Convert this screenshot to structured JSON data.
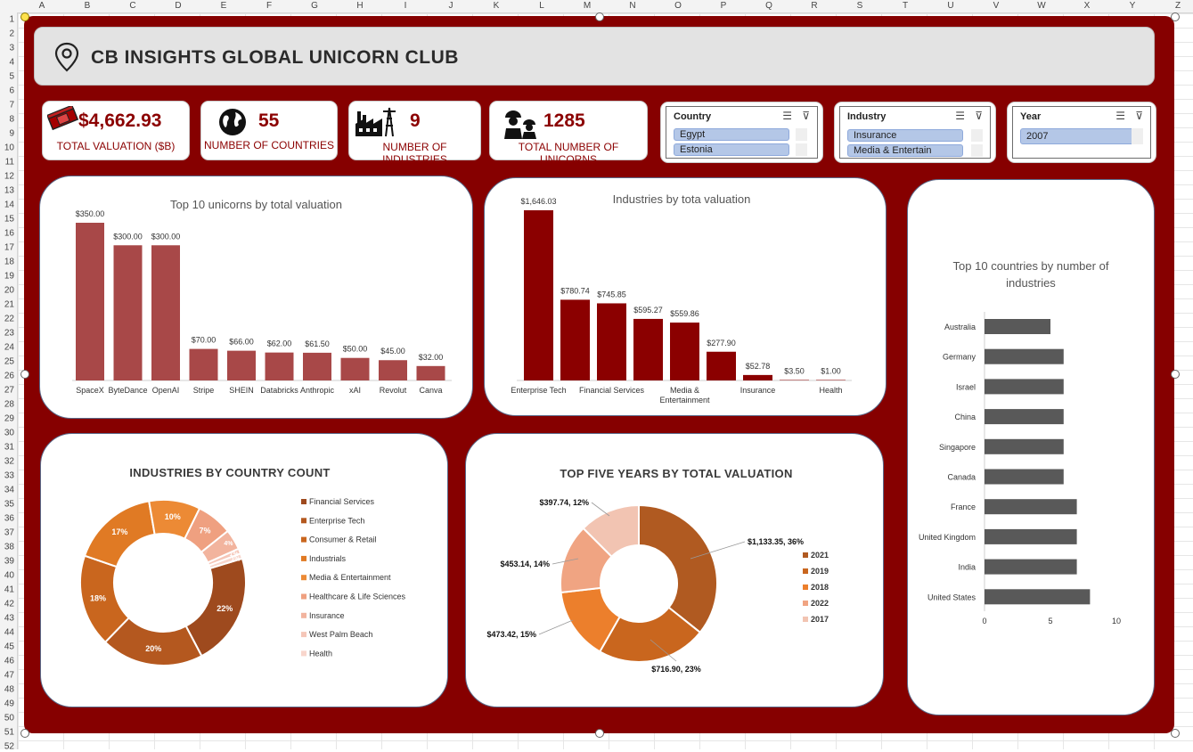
{
  "columns": [
    "A",
    "B",
    "C",
    "D",
    "E",
    "F",
    "G",
    "H",
    "I",
    "J",
    "K",
    "L",
    "M",
    "N",
    "O",
    "P",
    "Q",
    "R",
    "S",
    "T",
    "U",
    "V",
    "W",
    "X",
    "Y",
    "Z"
  ],
  "rows": [
    "1",
    "2",
    "3",
    "4",
    "5",
    "6",
    "7",
    "8",
    "9",
    "10",
    "11",
    "12",
    "13",
    "14",
    "15",
    "16",
    "17",
    "18",
    "19",
    "20",
    "21",
    "22",
    "23",
    "24",
    "25",
    "26",
    "27",
    "28",
    "29",
    "30",
    "31",
    "32",
    "33",
    "34",
    "35",
    "36",
    "37",
    "38",
    "39",
    "40",
    "41",
    "42",
    "43",
    "44",
    "45",
    "46",
    "47",
    "48",
    "49",
    "50",
    "51",
    "52"
  ],
  "title": "CB INSIGHTS GLOBAL UNICORN CLUB",
  "kpis": {
    "valuation": {
      "value": "$4,662.93",
      "label": "TOTAL VALUATION ($B)",
      "icon": "money-stack-icon"
    },
    "countries": {
      "value": "55",
      "label": "NUMBER OF COUNTRIES",
      "icon": "globe-icon"
    },
    "industries": {
      "value": "9",
      "label": "NUMBER OF INDUSTRIES",
      "icon": "factory-icon"
    },
    "unicorns": {
      "value": "1285",
      "label": "TOTAL NUMBER OF UNICORNS",
      "icon": "workers-icon"
    }
  },
  "slicers": {
    "country": {
      "header": "Country",
      "items": [
        "Egypt",
        "Estonia"
      ]
    },
    "industry": {
      "header": "Industry",
      "items": [
        "Insurance",
        "Media & Entertain"
      ]
    },
    "year": {
      "header": "Year",
      "items": [
        "2007"
      ]
    }
  },
  "colors": {
    "dashboard_bg": "#860000",
    "bar_unicorn": "#a84848",
    "bar_industry": "#8b0000",
    "bar_country": "#595959"
  },
  "chart_data": [
    {
      "type": "bar",
      "title": "Top 10 unicorns by total valuation",
      "categories": [
        "SpaceX",
        "ByteDance",
        "OpenAI",
        "Stripe",
        "SHEIN",
        "Databricks",
        "Anthropic",
        "xAI",
        "Revolut",
        "Canva"
      ],
      "values": [
        350,
        300,
        300,
        70,
        66,
        62,
        61.5,
        50,
        45,
        32
      ],
      "labels": [
        "$350.00",
        "$300.00",
        "$300.00",
        "$70.00",
        "$66.00",
        "$62.00",
        "$61.50",
        "$50.00",
        "$45.00",
        "$32.00"
      ],
      "ylim": [
        0,
        350
      ]
    },
    {
      "type": "bar",
      "title": "Industries by tota valuation",
      "categories": [
        "Enterprise Tech",
        "",
        "Financial Services",
        "",
        "Media & Entertainment",
        "",
        "Insurance",
        "",
        "Health"
      ],
      "values": [
        1646.03,
        780.74,
        745.85,
        595.27,
        559.86,
        277.9,
        52.78,
        3.5,
        1.0
      ],
      "labels": [
        "$1,646.03",
        "$780.74",
        "$745.85",
        "$595.27",
        "$559.86",
        "$277.90",
        "$52.78",
        "$3.50",
        "$1.00"
      ],
      "ylim": [
        0,
        1646.03
      ]
    },
    {
      "type": "bar",
      "orientation": "horizontal",
      "title": "Top 10 countries by number of industries",
      "categories": [
        "Australia",
        "Germany",
        "Israel",
        "China",
        "Singapore",
        "Canada",
        "France",
        "United Kingdom",
        "India",
        "United States"
      ],
      "values": [
        5,
        6,
        6,
        6,
        6,
        6,
        7,
        7,
        7,
        8
      ],
      "xticks": [
        "0",
        "5",
        "10"
      ],
      "xlim": [
        0,
        10
      ]
    },
    {
      "type": "pie",
      "title": "INDUSTRIES BY COUNTRY COUNT",
      "legend": [
        "Financial Services",
        "Enterprise Tech",
        "Consumer & Retail",
        "Industrials",
        "Media & Entertainment",
        "Healthcare & Life Sciences",
        "Insurance",
        "West Palm Beach",
        "Health"
      ],
      "values": [
        22,
        20,
        18,
        17,
        10,
        7,
        4,
        1,
        1
      ],
      "labels": [
        "22%",
        "20%",
        "18%",
        "17%",
        "10%",
        "7%",
        "4%",
        "1%",
        "1%"
      ],
      "colors": [
        "#9e4a1e",
        "#b4581f",
        "#c9661e",
        "#e07a24",
        "#ec8a35",
        "#efa080",
        "#f2b49e",
        "#f5c6b8",
        "#f8d6cc"
      ]
    },
    {
      "type": "pie",
      "title": "TOP FIVE YEARS BY TOTAL VALUATION",
      "legend": [
        "2021",
        "2019",
        "2018",
        "2022",
        "2017"
      ],
      "values": [
        1133.35,
        716.9,
        473.42,
        453.14,
        397.74
      ],
      "labels": [
        "$1,133.35, 36%",
        "$716.90, 23%",
        "$473.42, 15%",
        "$453.14, 14%",
        "$397.74, 12%"
      ],
      "colors": [
        "#b05a21",
        "#c9661e",
        "#ec7f2c",
        "#f0a482",
        "#f2c4b2"
      ]
    }
  ]
}
